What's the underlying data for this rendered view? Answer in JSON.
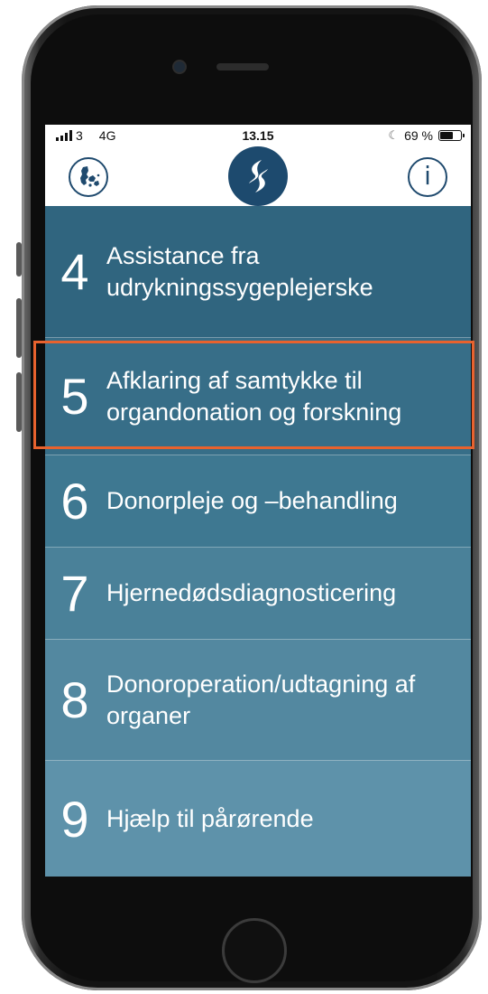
{
  "status_bar": {
    "carrier": "3",
    "network": "4G",
    "time": "13.15",
    "battery": "69 %",
    "battery_level": 0.69
  },
  "header": {
    "left_icon": "denmark-map-icon",
    "logo_icon": "dcd-logo-icon",
    "right_icon": "info-icon",
    "info_glyph": "i"
  },
  "menu": {
    "items": [
      {
        "number": "4",
        "label": "Assistance fra udrykningssygeplejerske",
        "color": "#30657f"
      },
      {
        "number": "5",
        "label": "Afklaring af samtykke til organdonation og forskning",
        "color": "#376e88",
        "highlighted": true
      },
      {
        "number": "6",
        "label": "Donorpleje og –behandling",
        "color": "#3e7891"
      },
      {
        "number": "7",
        "label": "Hjernedødsdiagnosticering",
        "color": "#4a8199"
      },
      {
        "number": "8",
        "label": "Donoroperation/udtagning af organer",
        "color": "#5388a0"
      },
      {
        "number": "9",
        "label": "Hjælp til pårørende",
        "color": "#5e92aa"
      }
    ]
  },
  "colors": {
    "header_brand": "#1d4a6e",
    "highlight": "#e8622e"
  }
}
